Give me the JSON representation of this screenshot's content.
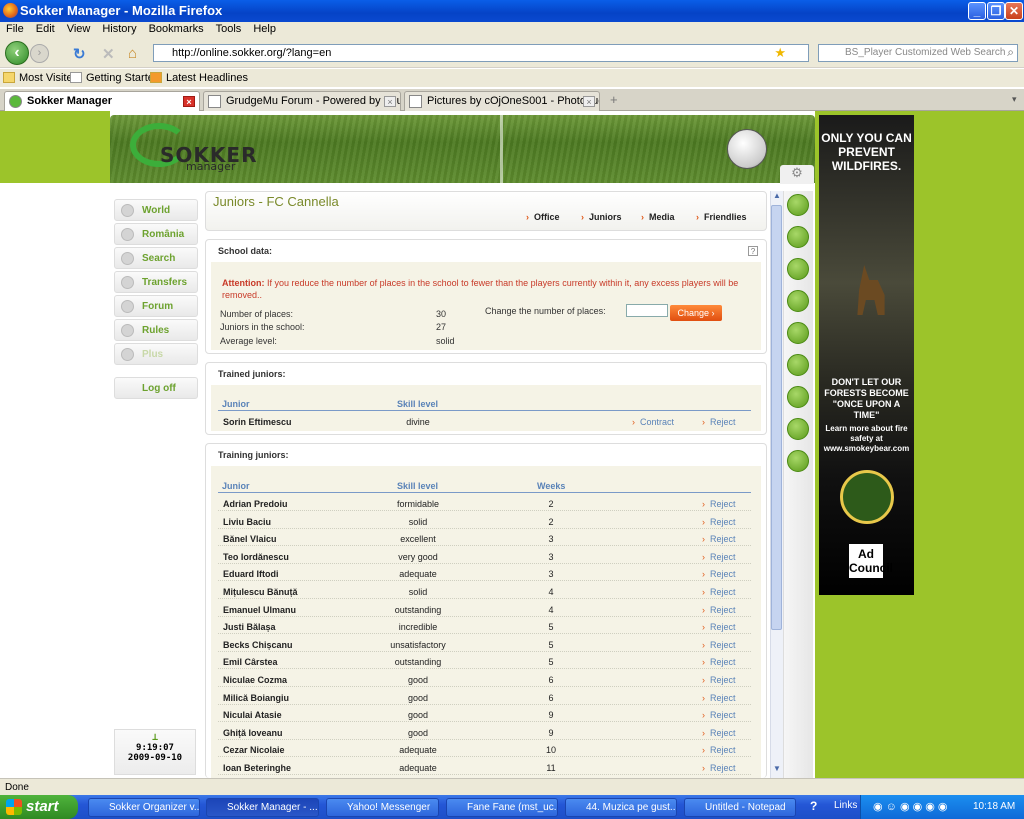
{
  "window": {
    "title": "Sokker Manager - Mozilla Firefox"
  },
  "menu": [
    "File",
    "Edit",
    "View",
    "History",
    "Bookmarks",
    "Tools",
    "Help"
  ],
  "nav": {
    "url": "http://online.sokker.org/?lang=en",
    "search_placeholder": "BS_Player Customized Web Search"
  },
  "bookmarks": [
    "Most Visited",
    "Getting Started",
    "Latest Headlines"
  ],
  "tabs": [
    {
      "label": "Sokker Manager",
      "active": true
    },
    {
      "label": "GrudgeMu Forum - Powered by vBulletin",
      "active": false
    },
    {
      "label": "Pictures by cOjOneS001 - Photobucket",
      "active": false
    }
  ],
  "site": {
    "logo": "SOKKER",
    "logo_sub": "manager"
  },
  "leftnav": [
    {
      "label": "World"
    },
    {
      "label": "România"
    },
    {
      "label": "Search"
    },
    {
      "label": "Transfers"
    },
    {
      "label": "Forum"
    },
    {
      "label": "Rules"
    },
    {
      "label": "Plus"
    },
    {
      "label": "Log off"
    }
  ],
  "clock": {
    "time": "9:19:07",
    "date": "2009-09-10"
  },
  "content": {
    "title": "Juniors - FC Cannella",
    "subnav": [
      "Office",
      "Juniors",
      "Media",
      "Friendlies"
    ]
  },
  "school": {
    "title": "School data:",
    "help": "?",
    "attention_label": "Attention:",
    "attention_text": "If you reduce the number of places in the school to fewer than the players currently within it, any excess players will be removed..",
    "places_label": "Number of places:",
    "places_value": "30",
    "juniors_label": "Juniors in the school:",
    "juniors_value": "27",
    "level_label": "Average level:",
    "level_value": "solid",
    "change_label": "Change the number of places:",
    "change_button": "Change"
  },
  "trained": {
    "title": "Trained juniors:",
    "col_junior": "Junior",
    "col_skill": "Skill level",
    "rows": [
      {
        "name": "Sorin Eftimescu",
        "skill": "divine",
        "contract": "Contract",
        "reject": "Reject"
      }
    ]
  },
  "training": {
    "title": "Training juniors:",
    "col_junior": "Junior",
    "col_skill": "Skill level",
    "col_weeks": "Weeks",
    "reject_label": "Reject",
    "rows": [
      {
        "name": "Adrian Predoiu",
        "skill": "formidable",
        "weeks": "2"
      },
      {
        "name": "Liviu Baciu",
        "skill": "solid",
        "weeks": "2"
      },
      {
        "name": "Bănel Vlaicu",
        "skill": "excellent",
        "weeks": "3"
      },
      {
        "name": "Teo Iordănescu",
        "skill": "very good",
        "weeks": "3"
      },
      {
        "name": "Eduard Iftodi",
        "skill": "adequate",
        "weeks": "3"
      },
      {
        "name": "Mițulescu Bănuță",
        "skill": "solid",
        "weeks": "4"
      },
      {
        "name": "Emanuel Ulmanu",
        "skill": "outstanding",
        "weeks": "4"
      },
      {
        "name": "Justi Bălașa",
        "skill": "incredible",
        "weeks": "5"
      },
      {
        "name": "Becks Chișcanu",
        "skill": "unsatisfactory",
        "weeks": "5"
      },
      {
        "name": "Emil Cârstea",
        "skill": "outstanding",
        "weeks": "5"
      },
      {
        "name": "Niculae Cozma",
        "skill": "good",
        "weeks": "6"
      },
      {
        "name": "Milică Boiangiu",
        "skill": "good",
        "weeks": "6"
      },
      {
        "name": "Niculai Atasie",
        "skill": "good",
        "weeks": "9"
      },
      {
        "name": "Ghiță Ioveanu",
        "skill": "good",
        "weeks": "9"
      },
      {
        "name": "Cezar Nicolaie",
        "skill": "adequate",
        "weeks": "10"
      },
      {
        "name": "Ioan Beteringhe",
        "skill": "adequate",
        "weeks": "11"
      }
    ]
  },
  "ad": {
    "headline": "ONLY YOU CAN PREVENT WILDFIRES.",
    "line2": "DON'T LET OUR FORESTS BECOME \"ONCE UPON A TIME\"",
    "line3": "Learn more about fire safety at www.smokeybear.com",
    "council": "Ad Council"
  },
  "status": "Done",
  "taskbar": {
    "start": "start",
    "items": [
      "Sokker Organizer v...",
      "Sokker Manager - ...",
      "Yahoo! Messenger",
      "Fane Fane (mst_uc...",
      "44. Muzica pe gust...",
      "Untitled - Notepad"
    ],
    "links": "Links",
    "time": "10:18 AM"
  },
  "colors": {
    "accent_green": "#9cc42a",
    "link_blue": "#5a83b8",
    "title_olive": "#7a8a2a",
    "button_orange": "#e04e10"
  }
}
